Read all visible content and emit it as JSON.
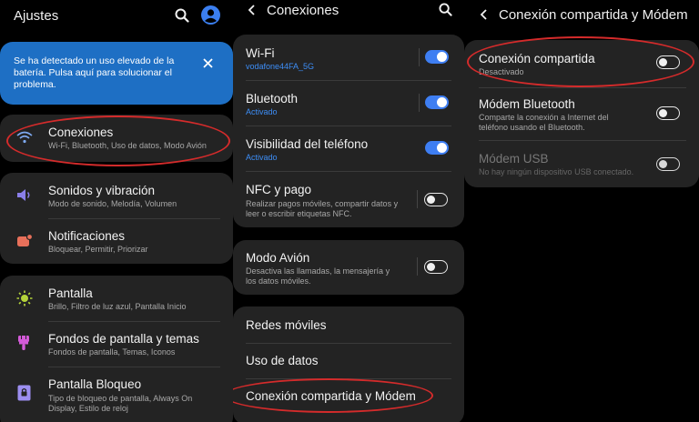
{
  "panel1": {
    "title": "Ajustes",
    "banner": {
      "text_l1": "Se ha detectado un uso elevado de la",
      "text_l2": "batería. Pulsa aquí para solucionar el",
      "text_l3": "problema."
    },
    "items": [
      {
        "title": "Conexiones",
        "subtitle": "Wi-Fi, Bluetooth, Uso de datos, Modo Avión"
      },
      {
        "title": "Sonidos y vibración",
        "subtitle": "Modo de sonido, Melodía, Volumen"
      },
      {
        "title": "Notificaciones",
        "subtitle": "Bloquear, Permitir, Priorizar"
      },
      {
        "title": "Pantalla",
        "subtitle": "Brillo, Filtro de luz azul, Pantalla Inicio"
      },
      {
        "title": "Fondos de pantalla y temas",
        "subtitle": "Fondos de pantalla, Temas, Iconos"
      },
      {
        "title": "Pantalla Bloqueo",
        "subtitle_l1": "Tipo de bloqueo de pantalla, Always On",
        "subtitle_l2": "Display, Estilo de reloj"
      }
    ]
  },
  "panel2": {
    "title": "Conexiones",
    "items": [
      {
        "title": "Wi-Fi",
        "subtitle": "vodafone44FA_5G",
        "toggle": "on"
      },
      {
        "title": "Bluetooth",
        "subtitle": "Activado",
        "toggle": "on"
      },
      {
        "title": "Visibilidad del teléfono",
        "subtitle": "Activado",
        "toggle": "on"
      },
      {
        "title": "NFC y pago",
        "subtitle_l1": "Realizar pagos móviles, compartir datos y",
        "subtitle_l2": "leer o escribir etiquetas NFC.",
        "toggle": "off"
      },
      {
        "title": "Modo Avión",
        "subtitle_l1": "Desactiva las llamadas, la mensajería y",
        "subtitle_l2": "los datos móviles.",
        "toggle": "off"
      },
      {
        "title": "Redes móviles"
      },
      {
        "title": "Uso de datos"
      },
      {
        "title": "Conexión compartida y Módem"
      }
    ]
  },
  "panel3": {
    "title": "Conexión compartida y Módem",
    "items": [
      {
        "title": "Conexión compartida",
        "subtitle": "Desactivado",
        "toggle": "off"
      },
      {
        "title": "Módem Bluetooth",
        "subtitle_l1": "Comparte la conexión a Internet del",
        "subtitle_l2": "teléfono usando el Bluetooth.",
        "toggle": "off"
      },
      {
        "title": "Módem USB",
        "subtitle": "No hay ningún dispositivo USB conectado.",
        "toggle": "off",
        "disabled": true
      }
    ]
  },
  "colors": {
    "background": "#000000",
    "card": "#232323",
    "banner": "#1e6fc4",
    "accent_blue": "#3e7ef2",
    "annotation_red": "#d42b2b"
  }
}
